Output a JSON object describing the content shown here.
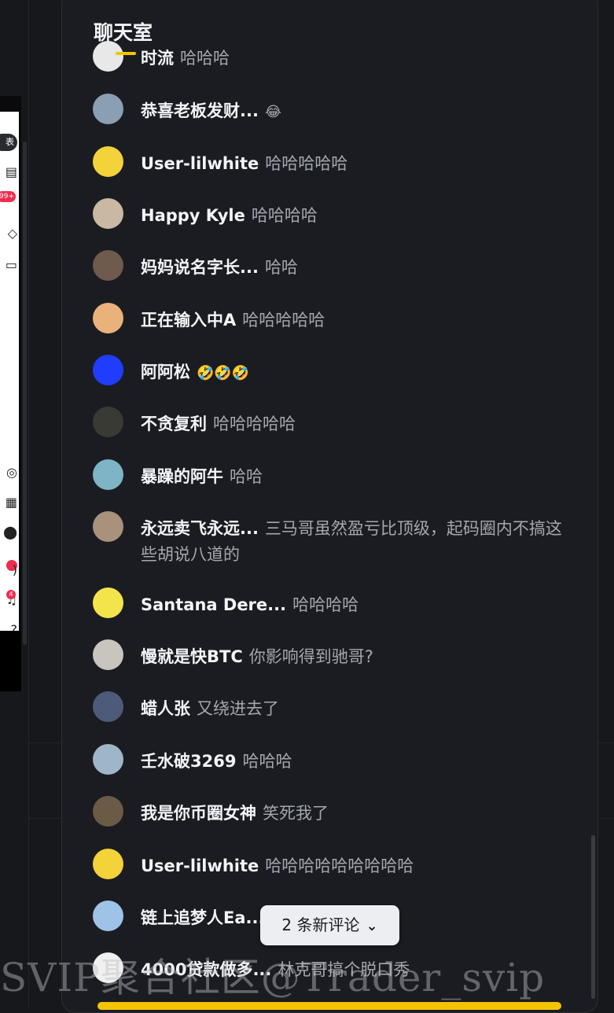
{
  "left_app": {
    "pill_text": "表",
    "badge_99": "99+",
    "bell_count": "4"
  },
  "chat": {
    "title": "聊天室",
    "messages": [
      {
        "user": "时流",
        "text": "哈哈哈",
        "avatar_color": "#e8e8e8"
      },
      {
        "user": "恭喜老板发财...",
        "text": "😂",
        "avatar_color": "#8a9fb3"
      },
      {
        "user": "User-lilwhite",
        "text": "哈哈哈哈哈",
        "avatar_color": "#f3d23a"
      },
      {
        "user": "Happy Kyle",
        "text": "哈哈哈哈",
        "avatar_color": "#c9b8a3"
      },
      {
        "user": "妈妈说名字长...",
        "text": "哈哈",
        "avatar_color": "#6f5a4e"
      },
      {
        "user": "正在输入中A",
        "text": "哈哈哈哈哈",
        "avatar_color": "#e9b27b"
      },
      {
        "user": "阿阿松",
        "text": "🤣🤣🤣",
        "avatar_color": "#1f3cff"
      },
      {
        "user": "不贪复利",
        "text": "哈哈哈哈哈",
        "avatar_color": "#3a3a35"
      },
      {
        "user": "暴躁的阿牛",
        "text": "哈哈",
        "avatar_color": "#7fb3c6"
      },
      {
        "user": "永远卖飞永远...",
        "text": "三马哥虽然盈亏比顶级，起码圈内不搞这些胡说八道的",
        "avatar_color": "#a8927c"
      },
      {
        "user": "Santana Dere...",
        "text": "哈哈哈哈",
        "avatar_color": "#f2e44a"
      },
      {
        "user": "慢就是快BTC",
        "text": "你影响得到驰哥?",
        "avatar_color": "#c8c5bd"
      },
      {
        "user": "蜡人张",
        "text": "又绕进去了",
        "avatar_color": "#4d5a7a"
      },
      {
        "user": "壬水破3269",
        "text": "哈哈哈",
        "avatar_color": "#9fb6c9"
      },
      {
        "user": "我是你币圈女神",
        "text": "笑死我了",
        "avatar_color": "#6b5a45"
      },
      {
        "user": "User-lilwhite",
        "text": "哈哈哈哈哈哈哈哈哈",
        "avatar_color": "#f3d23a"
      },
      {
        "user": "链上追梦人Ea...",
        "text": "",
        "avatar_color": "#9ec3e6"
      },
      {
        "user": "4000贷款做多...",
        "text": "林克哥搞个脱口秀",
        "avatar_color": "#f0f0f0"
      }
    ],
    "new_comments_label": "2 条新评论"
  },
  "watermark": "SVIP聚合社区@Trader_svip",
  "colors": {
    "background": "#17181c",
    "panel": "#1b1c21",
    "accent_yellow": "#f4c400",
    "badge_red": "#f02d4f"
  }
}
